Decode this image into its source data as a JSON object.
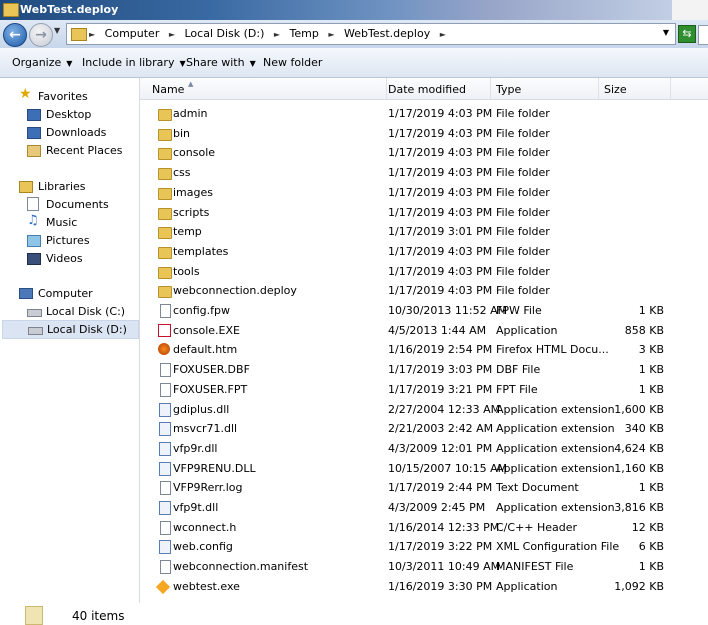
{
  "window": {
    "title": "WebTest.deploy"
  },
  "address": {
    "crumbs": [
      "Computer",
      "Local Disk (D:)",
      "Temp",
      "WebTest.deploy"
    ]
  },
  "toolbar": {
    "organize": "Organize",
    "include_in_library": "Include in library",
    "share_with": "Share with",
    "new_folder": "New folder"
  },
  "nav": {
    "favorites": {
      "label": "Favorites",
      "items": [
        "Desktop",
        "Downloads",
        "Recent Places"
      ]
    },
    "libraries": {
      "label": "Libraries",
      "items": [
        "Documents",
        "Music",
        "Pictures",
        "Videos"
      ]
    },
    "computer": {
      "label": "Computer",
      "items": [
        "Local Disk (C:)",
        "Local Disk (D:)"
      ]
    }
  },
  "columns": {
    "name": "Name",
    "date": "Date modified",
    "type": "Type",
    "size": "Size"
  },
  "files": [
    {
      "name": "admin",
      "date": "1/17/2019 4:03 PM",
      "type": "File folder",
      "size": "",
      "icon": "folder-icon"
    },
    {
      "name": "bin",
      "date": "1/17/2019 4:03 PM",
      "type": "File folder",
      "size": "",
      "icon": "folder-icon"
    },
    {
      "name": "console",
      "date": "1/17/2019 4:03 PM",
      "type": "File folder",
      "size": "",
      "icon": "folder-icon"
    },
    {
      "name": "css",
      "date": "1/17/2019 4:03 PM",
      "type": "File folder",
      "size": "",
      "icon": "folder-icon"
    },
    {
      "name": "images",
      "date": "1/17/2019 4:03 PM",
      "type": "File folder",
      "size": "",
      "icon": "folder-icon"
    },
    {
      "name": "scripts",
      "date": "1/17/2019 4:03 PM",
      "type": "File folder",
      "size": "",
      "icon": "folder-icon"
    },
    {
      "name": "temp",
      "date": "1/17/2019 3:01 PM",
      "type": "File folder",
      "size": "",
      "icon": "folder-icon"
    },
    {
      "name": "templates",
      "date": "1/17/2019 4:03 PM",
      "type": "File folder",
      "size": "",
      "icon": "folder-icon"
    },
    {
      "name": "tools",
      "date": "1/17/2019 4:03 PM",
      "type": "File folder",
      "size": "",
      "icon": "folder-icon"
    },
    {
      "name": "webconnection.deploy",
      "date": "1/17/2019 4:03 PM",
      "type": "File folder",
      "size": "",
      "icon": "folder-icon"
    },
    {
      "name": "config.fpw",
      "date": "10/30/2013 11:52 AM",
      "type": "FPW File",
      "size": "1 KB",
      "icon": "document-icon"
    },
    {
      "name": "console.EXE",
      "date": "4/5/2013 1:44 AM",
      "type": "Application",
      "size": "858 KB",
      "icon": "vfp-app-icon"
    },
    {
      "name": "default.htm",
      "date": "1/16/2019 2:54 PM",
      "type": "Firefox HTML Docu...",
      "size": "3 KB",
      "icon": "firefox-document-icon"
    },
    {
      "name": "FOXUSER.DBF",
      "date": "1/17/2019 3:03 PM",
      "type": "DBF File",
      "size": "1 KB",
      "icon": "document-icon"
    },
    {
      "name": "FOXUSER.FPT",
      "date": "1/17/2019 3:21 PM",
      "type": "FPT File",
      "size": "1 KB",
      "icon": "document-icon"
    },
    {
      "name": "gdiplus.dll",
      "date": "2/27/2004 12:33 AM",
      "type": "Application extension",
      "size": "1,600 KB",
      "icon": "dll-icon"
    },
    {
      "name": "msvcr71.dll",
      "date": "2/21/2003 2:42 AM",
      "type": "Application extension",
      "size": "340 KB",
      "icon": "dll-icon"
    },
    {
      "name": "vfp9r.dll",
      "date": "4/3/2009 12:01 PM",
      "type": "Application extension",
      "size": "4,624 KB",
      "icon": "dll-icon"
    },
    {
      "name": "VFP9RENU.DLL",
      "date": "10/15/2007 10:15 AM",
      "type": "Application extension",
      "size": "1,160 KB",
      "icon": "dll-icon"
    },
    {
      "name": "VFP9Rerr.log",
      "date": "1/17/2019 2:44 PM",
      "type": "Text Document",
      "size": "1 KB",
      "icon": "text-document-icon"
    },
    {
      "name": "vfp9t.dll",
      "date": "4/3/2009 2:45 PM",
      "type": "Application extension",
      "size": "3,816 KB",
      "icon": "dll-icon"
    },
    {
      "name": "wconnect.h",
      "date": "1/16/2014 12:33 PM",
      "type": "C/C++ Header",
      "size": "12 KB",
      "icon": "header-file-icon"
    },
    {
      "name": "web.config",
      "date": "1/17/2019 3:22 PM",
      "type": "XML Configuration File",
      "size": "6 KB",
      "icon": "config-file-icon"
    },
    {
      "name": "webconnection.manifest",
      "date": "10/3/2011 10:49 AM",
      "type": "MANIFEST File",
      "size": "1 KB",
      "icon": "document-icon"
    },
    {
      "name": "webtest.exe",
      "date": "1/16/2019 3:30 PM",
      "type": "Application",
      "size": "1,092 KB",
      "icon": "webtest-app-icon"
    }
  ],
  "status": {
    "item_count": "40 items"
  }
}
